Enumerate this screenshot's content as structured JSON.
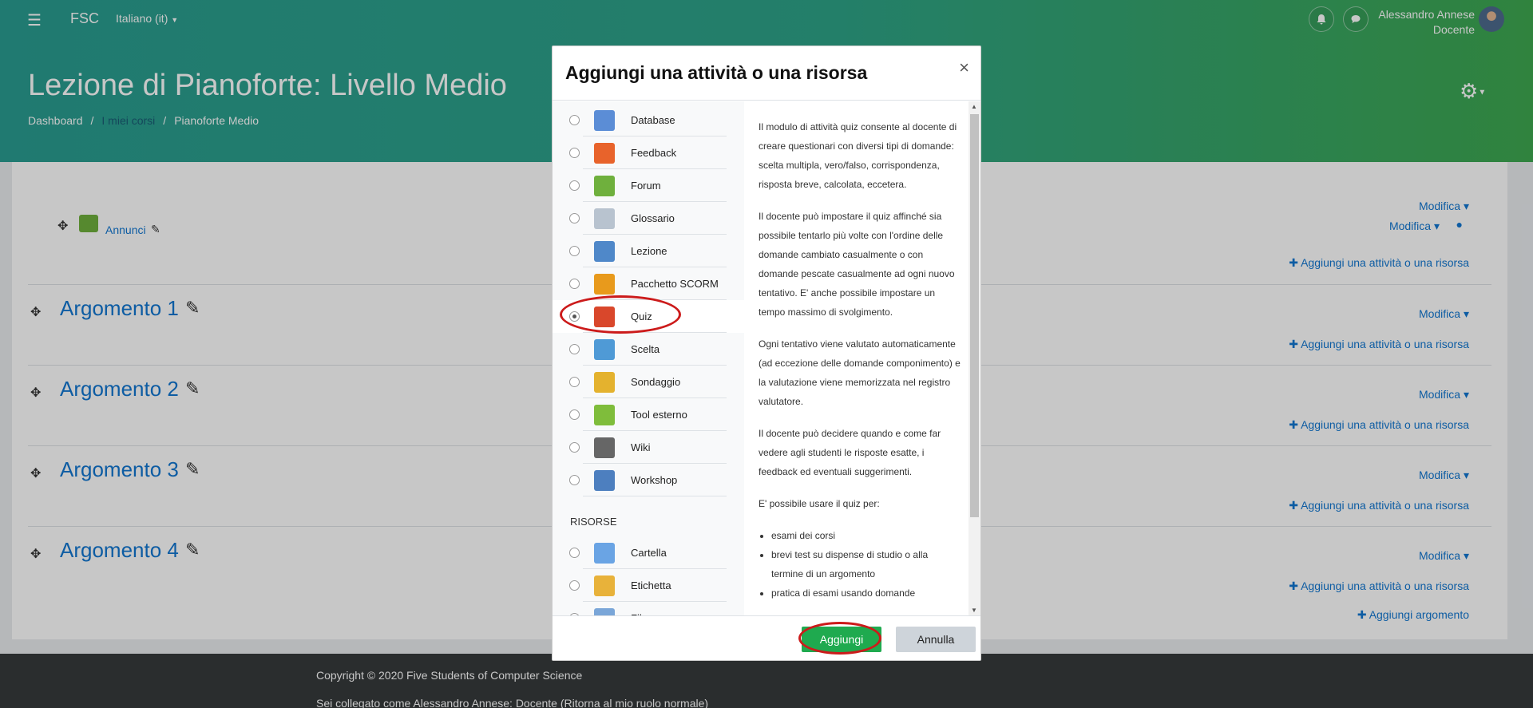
{
  "topbar": {
    "menu_icon": "☰",
    "brand": "FSC",
    "language": "Italiano (it)",
    "user_name": "Alessandro Annese",
    "user_role": "Docente"
  },
  "header": {
    "title": "Lezione di Pianoforte: Livello Medio",
    "breadcrumbs": [
      "Dashboard",
      "I miei corsi",
      "Pianoforte Medio"
    ]
  },
  "course": {
    "announcement": "Annunci",
    "modify_label": "Modifica",
    "add_activity_label": "Aggiungi una attività o una risorsa",
    "add_topic_label": "Aggiungi argomento",
    "sections": [
      "Argomento 1",
      "Argomento 2",
      "Argomento 3",
      "Argomento 4"
    ]
  },
  "footer": {
    "copyright": "Copyright © 2020 Five Students of Computer Science",
    "login_info": "Sei collegato come Alessandro Annese: Docente (Ritorna al mio ruolo normale)"
  },
  "modal": {
    "title": "Aggiungi una attività o una risorsa",
    "close": "×",
    "activities": [
      {
        "label": "Database",
        "icon": "database-icon",
        "color": "#5b8dd6"
      },
      {
        "label": "Feedback",
        "icon": "megaphone-icon",
        "color": "#e8632b"
      },
      {
        "label": "Forum",
        "icon": "forum-icon",
        "color": "#6fb03d"
      },
      {
        "label": "Glossario",
        "icon": "glossary-icon",
        "color": "#b8c3cf"
      },
      {
        "label": "Lezione",
        "icon": "lesson-icon",
        "color": "#4f88c9"
      },
      {
        "label": "Pacchetto SCORM",
        "icon": "scorm-package-icon",
        "color": "#e89a1c"
      },
      {
        "label": "Quiz",
        "icon": "quiz-icon",
        "color": "#d9472b"
      },
      {
        "label": "Scelta",
        "icon": "question-mark-icon",
        "color": "#4f9ad6"
      },
      {
        "label": "Sondaggio",
        "icon": "bar-chart-icon",
        "color": "#e4b22e"
      },
      {
        "label": "Tool esterno",
        "icon": "puzzle-icon",
        "color": "#7fbd3b"
      },
      {
        "label": "Wiki",
        "icon": "wiki-icon",
        "color": "#666666"
      },
      {
        "label": "Workshop",
        "icon": "workshop-icon",
        "color": "#4d7fbf"
      }
    ],
    "resources_heading": "RISORSE",
    "resources": [
      {
        "label": "Cartella",
        "icon": "folder-icon",
        "color": "#6aa4e4"
      },
      {
        "label": "Etichetta",
        "icon": "tag-icon",
        "color": "#e8b23a"
      },
      {
        "label": "File",
        "icon": "file-icon",
        "color": "#7aa6d8"
      }
    ],
    "selected": "Quiz",
    "description": [
      "Il modulo di attività quiz consente al docente di creare questionari con diversi tipi di domande: scelta multipla, vero/falso, corrispondenza, risposta breve, calcolata, eccetera.",
      "Il docente può impostare il quiz affinché sia possibile tentarlo più volte con l'ordine delle domande cambiato casualmente o con domande pescate casualmente ad ogni nuovo tentativo. E' anche possibile impostare un tempo massimo di svolgimento.",
      "Ogni tentativo viene valutato automaticamente (ad eccezione delle domande componimento) e la valutazione viene memorizzata nel registro valutatore.",
      "Il docente può decidere quando e come far vedere agli studenti le risposte esatte, i feedback ed eventuali suggerimenti.",
      "E' possibile usare il quiz per:"
    ],
    "uses": [
      "esami dei corsi",
      "brevi test su dispense di studio o alla termine di un argomento",
      "pratica di esami usando domande"
    ],
    "add_button": "Aggiungi",
    "cancel_button": "Annulla",
    "highlight_color": "#cc1b1b"
  }
}
